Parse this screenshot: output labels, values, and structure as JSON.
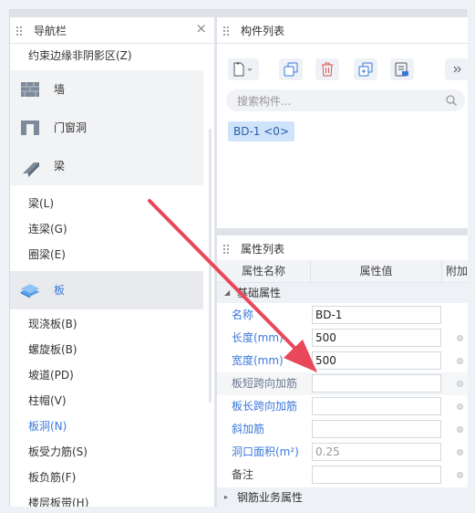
{
  "nav": {
    "title": "导航栏",
    "items_top": [
      "约束边缘非阴影区(Z)"
    ],
    "cats": [
      {
        "label": "墙",
        "icon": "wall-icon"
      },
      {
        "label": "门窗洞",
        "icon": "door-window-icon"
      },
      {
        "label": "梁",
        "icon": "beam-icon"
      }
    ],
    "beam_items": [
      "梁(L)",
      "连梁(G)",
      "圈梁(E)"
    ],
    "slab_cat": {
      "label": "板",
      "icon": "slab-icon"
    },
    "slab_items": [
      "现浇板(B)",
      "螺旋板(B)",
      "坡道(PD)",
      "柱帽(V)",
      "板洞(N)",
      "板受力筋(S)",
      "板负筋(F)",
      "楼层板带(H)"
    ]
  },
  "components": {
    "title": "构件列表",
    "search_placeholder": "搜索构件...",
    "item": "BD-1 <0>"
  },
  "properties": {
    "title": "属性列表",
    "col_name": "属性名称",
    "col_value": "属性值",
    "col_extra": "附加",
    "group_basic": "基础属性",
    "rows": [
      {
        "name": "名称",
        "value": "BD-1"
      },
      {
        "name": "长度(mm)",
        "value": "500"
      },
      {
        "name": "宽度(mm)",
        "value": "500"
      },
      {
        "name": "板短跨向加筋",
        "value": ""
      },
      {
        "name": "板长跨向加筋",
        "value": ""
      },
      {
        "name": "斜加筋",
        "value": ""
      },
      {
        "name": "洞口面积(m²)",
        "value": "0.25"
      },
      {
        "name": "备注",
        "value": ""
      }
    ],
    "group_rebar": "钢筋业务属性"
  },
  "colors": {
    "accent": "#3a78d8",
    "arrow": "#e8485a"
  }
}
